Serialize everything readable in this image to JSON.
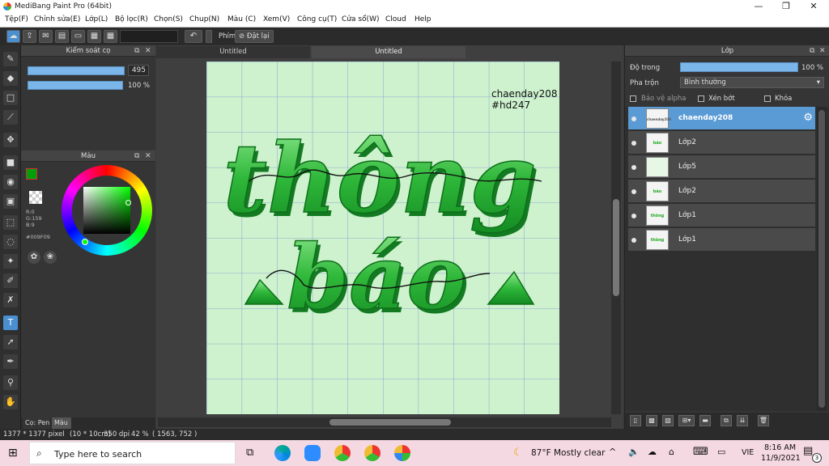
{
  "window": {
    "title": "MediBang Paint Pro (64bit)",
    "minimize": "—",
    "restore": "❐",
    "close": "✕"
  },
  "menu": [
    "Tệp(F)",
    "Chỉnh sửa(E)",
    "Lớp(L)",
    "Bộ lọc(R)",
    "Chọn(S)",
    "Chup(N)",
    "Màu (C)",
    "Xem(V)",
    "Công cụ(T)",
    "Cửa sổ(W)",
    "Cloud",
    "Help"
  ],
  "toolbar": {
    "phim_label": "Phím",
    "reset_label": "Đặt lại"
  },
  "brush_panel": {
    "title": "Kiểm soát cọ",
    "size_value": "495",
    "opacity_value": "100 %"
  },
  "color_panel": {
    "title": "Màu",
    "rgb_r": "R:0",
    "rgb_g": "G:159",
    "rgb_b": "B:9",
    "hex": "#009F09",
    "main_color": "#009f09"
  },
  "left_tabs": {
    "pen": "Cọ: Pen",
    "color": "Màu"
  },
  "tabs": [
    "Untitled",
    "Untitled"
  ],
  "canvas": {
    "watermark_line1": "chaenday208",
    "watermark_line2": "#hd247",
    "headline_line1": "thông",
    "headline_line2": "báo",
    "background": "#cdf2cd",
    "text_color": "#2fb83a"
  },
  "layer_panel": {
    "title": "Lớp",
    "opacity_label": "Độ trong",
    "opacity_value": "100 %",
    "opacity_fraction": 1.0,
    "blend_label": "Pha trộn",
    "blend_value": "Bình thường",
    "protect_alpha": "Bảo vệ alpha",
    "clipping": "Xén bớt",
    "lock": "Khóa",
    "layers": [
      {
        "name": "chaenday208",
        "thumb": "chaenday208",
        "selected": true
      },
      {
        "name": "Lớp2",
        "thumb": "báo",
        "selected": false
      },
      {
        "name": "Lớp5",
        "thumb": "",
        "selected": false
      },
      {
        "name": "Lớp2",
        "thumb": "báo",
        "selected": false
      },
      {
        "name": "Lớp1",
        "thumb": "thông",
        "selected": false
      },
      {
        "name": "Lớp1",
        "thumb": "thông",
        "selected": false
      }
    ]
  },
  "status": {
    "size": "1377 * 1377 pixel",
    "cm": "(10 * 10cm)",
    "dpi": "350 dpi",
    "zoom": "42 %",
    "coords": "( 1563, 752 )"
  },
  "taskbar": {
    "search_placeholder": "Type here to search",
    "weather": "87°F  Mostly clear",
    "lang": "VIE",
    "time": "8:16 AM",
    "date": "11/9/2021",
    "notif_count": "3"
  }
}
